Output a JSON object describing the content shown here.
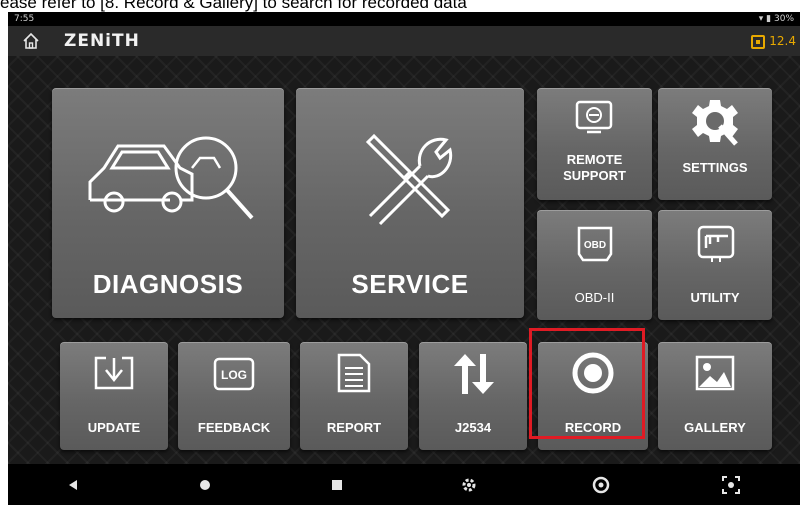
{
  "caption": "ease refer to [8. Record & Gallery] to search for recorded data",
  "status": {
    "time": "7:55",
    "right": "▾ ▮ 30%"
  },
  "app": {
    "logo": "ZENiTH",
    "battery": "12.4"
  },
  "tiles": {
    "diagnosis": "DIAGNOSIS",
    "service": "SERVICE",
    "remote_support_1": "REMOTE",
    "remote_support_2": "SUPPORT",
    "settings": "SETTINGS",
    "obd2": "OBD-II",
    "obd_icon_text": "OBD",
    "utility": "UTILITY",
    "update": "UPDATE",
    "feedback": "FEEDBACK",
    "log_icon_text": "LOG",
    "report": "REPORT",
    "j2534": "J2534",
    "record": "RECORD",
    "gallery": "GALLERY"
  },
  "colors": {
    "highlight": "#e01b24",
    "battery": "#e8a900"
  }
}
